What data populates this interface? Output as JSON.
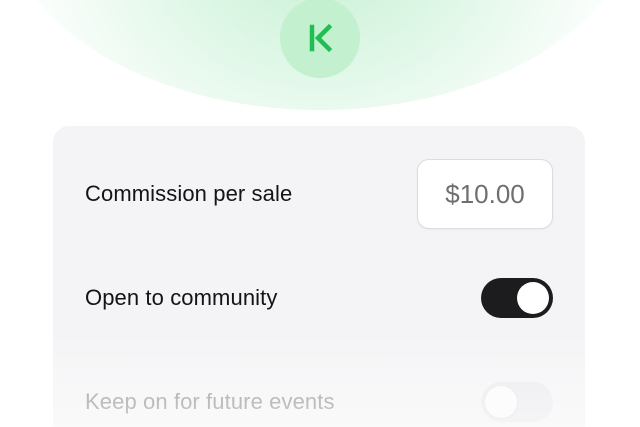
{
  "brand": {
    "logo_icon": "kick-k-logo-icon",
    "accent_color": "#1fbe52",
    "badge_color": "#c3f0cf"
  },
  "settings": {
    "commission": {
      "label": "Commission per sale",
      "value": "$10.00"
    },
    "open_to_community": {
      "label": "Open to community",
      "enabled": true
    },
    "keep_on_future": {
      "label": "Keep on for future events",
      "enabled": false
    }
  }
}
